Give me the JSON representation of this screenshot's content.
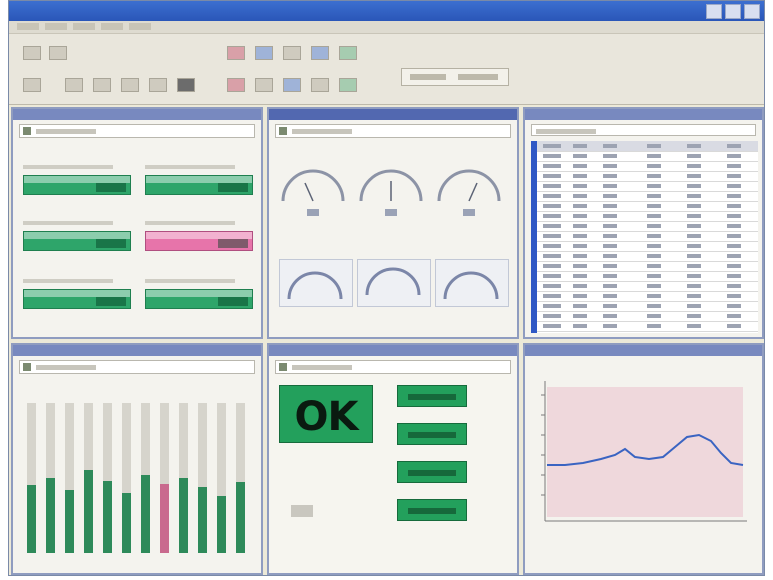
{
  "status_panel": {
    "ok_label": "OK"
  },
  "colors": {
    "title_bar": "#2a56b8",
    "panel_border": "#8f9cc0",
    "status_green": "#23a05c",
    "alarm_pink": "#e774aa",
    "grid_highlight": "#2f58c5",
    "trend_line": "#3a64c2",
    "trend_background": "#efd8dc"
  },
  "icons": {
    "window_controls": [
      "minimize-icon",
      "maximize-icon",
      "close-icon"
    ],
    "toolbar": [
      "document-icon",
      "folder-icon",
      "gauge-icon",
      "graph-icon",
      "table-icon",
      "alarm-icon",
      "settings-icon",
      "print-icon"
    ]
  },
  "bar_indicators": [
    {
      "status": "normal"
    },
    {
      "status": "normal"
    },
    {
      "status": "normal"
    },
    {
      "status": "alarm"
    },
    {
      "status": "normal"
    },
    {
      "status": "normal"
    }
  ],
  "vertical_bar_levels": [
    0.45,
    0.5,
    0.42,
    0.55,
    0.48,
    0.4,
    0.52,
    0.46,
    0.5,
    0.44,
    0.38,
    0.47
  ]
}
